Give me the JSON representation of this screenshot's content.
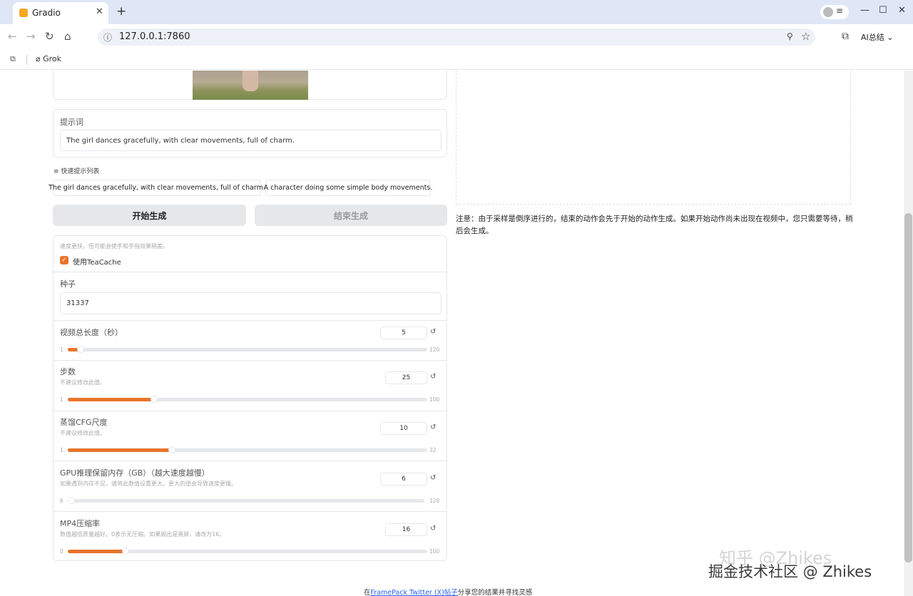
{
  "browser": {
    "tab_title": "Gradio",
    "url": "127.0.0.1:7860",
    "ai_summary_label": "AI总结",
    "bookmark": "Grok"
  },
  "left": {
    "prompt_label": "提示词",
    "prompt_value": "The girl dances gracefully, with clear movements, full of charm.",
    "quick_list_label": "快速提示列表",
    "quick_items": [
      "The girl dances gracefully, with clear movements, full of charm.",
      "A character doing some simple body movements."
    ],
    "start_button": "开始生成",
    "end_button": "结束生成",
    "teacache_hint": "速度更快，但可能会使手和手指效果稍差。",
    "teacache_label": "使用TeaCache",
    "teacache_checked": true,
    "seed_label": "种子",
    "seed_value": "31337",
    "sliders": [
      {
        "label": "视频总长度（秒）",
        "hint": "",
        "value": "5",
        "min": "1",
        "max": "120",
        "fraction": 0.035
      },
      {
        "label": "步数",
        "hint": "不建议修改此值。",
        "value": "25",
        "min": "1",
        "max": "100",
        "fraction": 0.24
      },
      {
        "label": "蒸馏CFG尺度",
        "hint": "不建议修改此值。",
        "value": "10",
        "min": "1",
        "max": "32",
        "fraction": 0.29
      },
      {
        "label": "GPU推理保留内存（GB）（越大速度越慢）",
        "hint": "如果遇到内存不足，请将此数值设置更大。更大的值会导致速度更慢。",
        "value": "6",
        "min": "6",
        "max": "128",
        "fraction": 0.0
      },
      {
        "label": "MP4压缩率",
        "hint": "数值越低质量越好。0表示无压缩。如果输出是黑屏，请改为16。",
        "value": "16",
        "min": "0",
        "max": "100",
        "fraction": 0.16
      }
    ]
  },
  "right": {
    "note": "注意：由于采样是倒序进行的，结束的动作会先于开始的动作生成。如果开始动作尚未出现在视频中，您只需要等待，稍后会生成。"
  },
  "footer": {
    "prefix": "在",
    "link1": "FramePack Twitter (X)",
    "link2": "帖子",
    "suffix": "分享您的结果并寻找灵感"
  },
  "watermark": {
    "line1": "知乎 @Zhikes",
    "line2": "掘金技术社区 @ Zhikes"
  },
  "colors": {
    "accent": "#e8742a",
    "chrome": "#dfe7f6"
  }
}
